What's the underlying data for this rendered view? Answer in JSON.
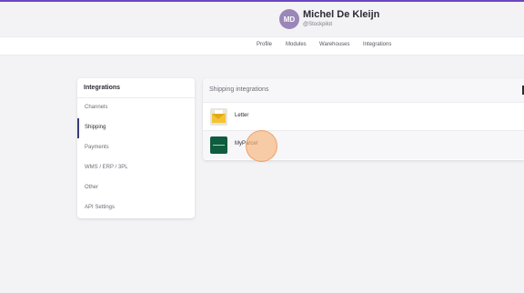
{
  "user": {
    "initials": "MD",
    "name": "Michel De Kleijn",
    "handle": "@Stockpilot"
  },
  "nav": {
    "items": [
      "Profile",
      "Modules",
      "Warehouses",
      "Integrations"
    ]
  },
  "sidebar": {
    "title": "Integrations",
    "items": [
      {
        "label": "Channels",
        "active": false
      },
      {
        "label": "Shipping",
        "active": true
      },
      {
        "label": "Payments",
        "active": false
      },
      {
        "label": "WMS / ERP / 3PL",
        "active": false
      },
      {
        "label": "Other",
        "active": false
      },
      {
        "label": "API Settings",
        "active": false
      }
    ]
  },
  "panel": {
    "title": "Shipping integrations",
    "integrations": [
      {
        "label": "Letter",
        "icon": "letter-envelope-icon"
      },
      {
        "label": "MyParcel",
        "icon": "myparcel-logo-icon"
      }
    ]
  },
  "colors": {
    "accent": "#6b46c1",
    "avatar_bg": "#9b86b8",
    "active_indicator": "#3a3a7a",
    "myparcel_green": "#0f5c3f",
    "click_highlight": "#f8b478"
  }
}
